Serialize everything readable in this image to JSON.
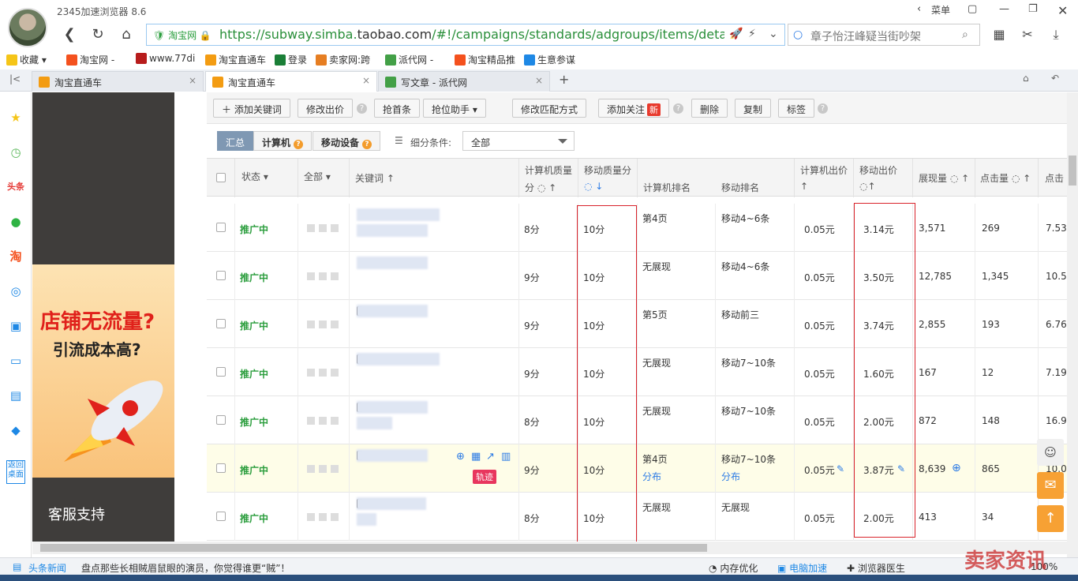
{
  "browser": {
    "title": "2345加速浏览器 8.6",
    "menu": "菜单",
    "security": "淘宝网",
    "url_green": "https://subway.simba.",
    "url_domain": "taobao.com",
    "url_rest": "/#!/campaigns/standards/adgroups/items/detail?tab=",
    "search_text": "章子怡汪峰疑当街吵架"
  },
  "bookmarks": [
    {
      "label": "收藏",
      "color": "#f5c518"
    },
    {
      "label": "淘宝网 -",
      "color": "#f4511e"
    },
    {
      "label": "www.77di",
      "color": "#b71c1c"
    },
    {
      "label": "淘宝直通车",
      "color": "#f39c12"
    },
    {
      "label": "登录",
      "color": "#1a7f37"
    },
    {
      "label": "卖家网:跨",
      "color": "#e67e22"
    },
    {
      "label": "派代网 -",
      "color": "#43a047"
    },
    {
      "label": "淘宝精品推",
      "color": "#f4511e"
    },
    {
      "label": "生意参谋",
      "color": "#1e88e5"
    }
  ],
  "tabs": [
    {
      "label": "淘宝直通车",
      "color": "#f39c12"
    },
    {
      "label": "淘宝直通车",
      "color": "#f39c12"
    },
    {
      "label": "写文章 - 派代网",
      "color": "#43a047"
    }
  ],
  "promo": {
    "line1": "店铺无流量?",
    "line2": "引流成本高?",
    "support": "客服支持"
  },
  "toolbar": {
    "add_keyword": "添加关键词",
    "modify_bid": "修改出价",
    "grab_first": "抢首条",
    "grab_helper": "抢位助手",
    "modify_match": "修改匹配方式",
    "add_follow": "添加关注",
    "new_badge": "新",
    "delete": "删除",
    "copy": "复制",
    "tag": "标签"
  },
  "filter": {
    "summary": "汇总",
    "computer": "计算机",
    "mobile": "移动设备",
    "condition_label": "细分条件:",
    "condition_value": "全部"
  },
  "headers": {
    "status": "状态",
    "all": "全部",
    "keyword": "关键词",
    "pc_quality": "计算机质量",
    "pc_quality2": "分",
    "mobile_quality": "移动质量分",
    "pc_rank": "计算机排名",
    "mobile_rank": "移动排名",
    "pc_bid": "计算机出价",
    "mobile_bid": "移动出价",
    "impressions": "展现量",
    "clicks": "点击量",
    "ctr": "点击"
  },
  "rows": [
    {
      "status": "推广中",
      "pc_q": "8分",
      "m_q": "10分",
      "pc_rank": "第4页",
      "pc_rank_sub": "",
      "m_rank": "移动4~6条",
      "m_rank_sub": "",
      "pc_bid": "0.05元",
      "m_bid": "3.14元",
      "imp": "3,571",
      "clk": "269",
      "ctr": "7.53"
    },
    {
      "status": "推广中",
      "pc_q": "9分",
      "m_q": "10分",
      "pc_rank": "无展现",
      "pc_rank_sub": "",
      "m_rank": "移动4~6条",
      "m_rank_sub": "",
      "pc_bid": "0.05元",
      "m_bid": "3.50元",
      "imp": "12,785",
      "clk": "1,345",
      "ctr": "10.5"
    },
    {
      "status": "推广中",
      "pc_q": "9分",
      "m_q": "10分",
      "pc_rank": "第5页",
      "pc_rank_sub": "",
      "m_rank": "移动前三",
      "m_rank_sub": "",
      "pc_bid": "0.05元",
      "m_bid": "3.74元",
      "imp": "2,855",
      "clk": "193",
      "ctr": "6.76"
    },
    {
      "status": "推广中",
      "pc_q": "9分",
      "m_q": "10分",
      "pc_rank": "无展现",
      "pc_rank_sub": "",
      "m_rank": "移动7~10条",
      "m_rank_sub": "",
      "pc_bid": "0.05元",
      "m_bid": "1.60元",
      "imp": "167",
      "clk": "12",
      "ctr": "7.19"
    },
    {
      "status": "推广中",
      "pc_q": "8分",
      "m_q": "10分",
      "pc_rank": "无展现",
      "pc_rank_sub": "",
      "m_rank": "移动7~10条",
      "m_rank_sub": "",
      "pc_bid": "0.05元",
      "m_bid": "2.00元",
      "imp": "872",
      "clk": "148",
      "ctr": "16.9"
    },
    {
      "status": "推广中",
      "pc_q": "9分",
      "m_q": "10分",
      "pc_rank": "第4页",
      "pc_rank_sub": "分布",
      "m_rank": "移动7~10条",
      "m_rank_sub": "分布",
      "pc_bid": "0.05元",
      "m_bid": "3.87元",
      "imp": "8,639",
      "clk": "865",
      "ctr": "10.0",
      "trace": "轨迹"
    },
    {
      "status": "推广中",
      "pc_q": "8分",
      "m_q": "10分",
      "pc_rank": "无展现",
      "pc_rank_sub": "",
      "m_rank": "无展现",
      "m_rank_sub": "",
      "pc_bid": "0.05元",
      "m_bid": "2.00元",
      "imp": "413",
      "clk": "34",
      "ctr": ""
    }
  ],
  "statusbar": {
    "news": "头条新闻",
    "headline": "盘点那些长相贼眉鼠眼的演员，你觉得谁更“贼”！",
    "mem": "内存优化",
    "speed": "电脑加速",
    "doctor": "浏览器医生",
    "zoom": "100%"
  },
  "sidebar": {
    "back_desktop": "返回桌面"
  },
  "watermark": "卖家资讯"
}
